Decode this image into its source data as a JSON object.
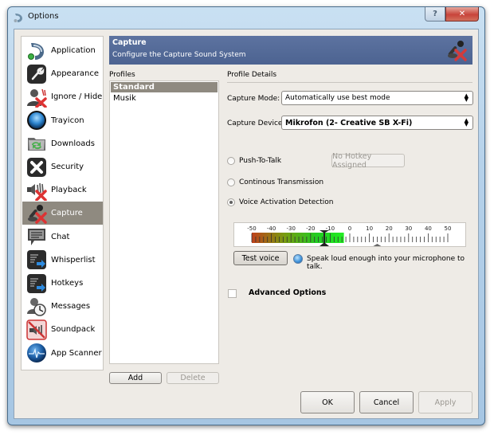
{
  "window": {
    "title": "Options",
    "help_label": "?",
    "close_label": "✕"
  },
  "nav": {
    "items": [
      {
        "label": "Application",
        "icon": "teamspeak-logo-icon",
        "active": false
      },
      {
        "label": "Appearance",
        "icon": "wrench-icon",
        "active": false
      },
      {
        "label": "Ignore / Hide",
        "icon": "user-blocked-icon",
        "active": false
      },
      {
        "label": "Trayicon",
        "icon": "blue-orb-icon",
        "active": false
      },
      {
        "label": "Downloads",
        "icon": "folder-sync-icon",
        "active": false
      },
      {
        "label": "Security",
        "icon": "security-x-icon",
        "active": false
      },
      {
        "label": "Playback",
        "icon": "speaker-muted-icon",
        "active": false
      },
      {
        "label": "Capture",
        "icon": "microphone-muted-icon",
        "active": true
      },
      {
        "label": "Chat",
        "icon": "chat-bubble-icon",
        "active": false
      },
      {
        "label": "Whisperlist",
        "icon": "whisperlist-icon",
        "active": false
      },
      {
        "label": "Hotkeys",
        "icon": "hotkeys-icon",
        "active": false
      },
      {
        "label": "Messages",
        "icon": "user-clock-icon",
        "active": false
      },
      {
        "label": "Soundpack",
        "icon": "soundpack-muted-icon",
        "active": false
      },
      {
        "label": "App Scanner",
        "icon": "app-scanner-icon",
        "active": false
      }
    ]
  },
  "header": {
    "title": "Capture",
    "subtitle": "Configure the Capture Sound System"
  },
  "profiles": {
    "label": "Profiles",
    "items": [
      {
        "label": "Standard",
        "selected": true
      },
      {
        "label": "Musik",
        "selected": false
      }
    ],
    "add_label": "Add",
    "delete_label": "Delete"
  },
  "details": {
    "label": "Profile Details",
    "capture_mode_label": "Capture Mode:",
    "capture_mode_value": "Automatically use best mode",
    "capture_device_label": "Capture Device:",
    "capture_device_value": "Mikrofon (2- Creative SB X-Fi)",
    "radios": [
      {
        "label": "Push-To-Talk",
        "checked": false
      },
      {
        "label": "Continous Transmission",
        "checked": false
      },
      {
        "label": "Voice Activation Detection",
        "checked": true
      }
    ],
    "hotkey_label": "No Hotkey Assigned",
    "meter": {
      "ticks": [
        "-50",
        "-40",
        "-30",
        "-20",
        "-10",
        "0",
        "10",
        "20",
        "30",
        "40",
        "50"
      ],
      "min": -50,
      "max": 50,
      "level": -3,
      "threshold": -13,
      "marker": 14
    },
    "test_voice_label": "Test voice",
    "status_text": "Speak loud enough into your microphone to talk.",
    "advanced_label": "Advanced Options",
    "advanced_checked": false
  },
  "footer": {
    "ok_label": "OK",
    "cancel_label": "Cancel",
    "apply_label": "Apply"
  }
}
